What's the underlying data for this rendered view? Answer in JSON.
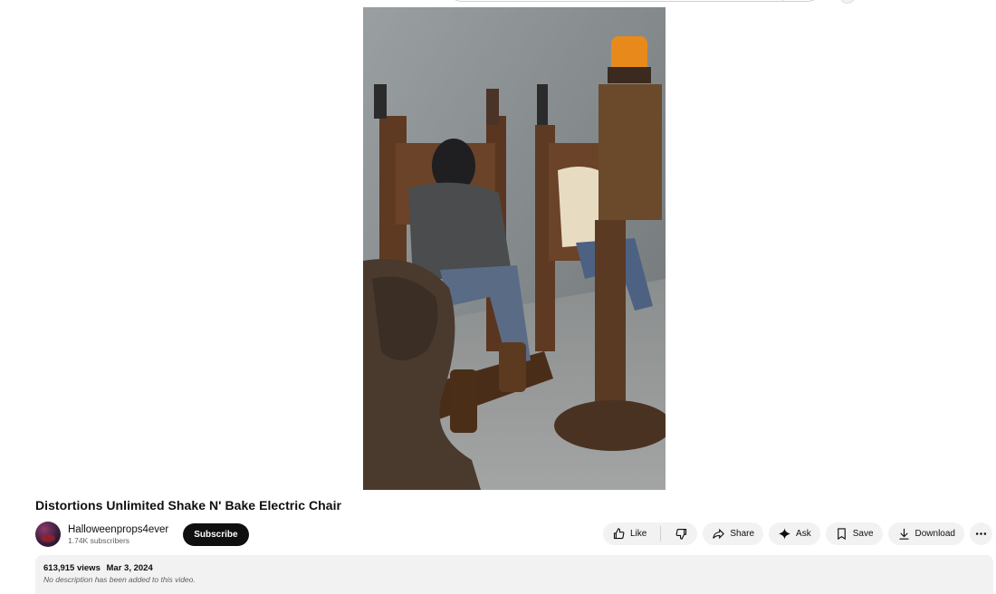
{
  "video": {
    "title": "Distortions Unlimited Shake N' Bake Electric Chair"
  },
  "channel": {
    "name": "Halloweenprops4ever",
    "subscribers": "1.74K subscribers",
    "subscribe_label": "Subscribe"
  },
  "actions": {
    "like": "Like",
    "share": "Share",
    "ask": "Ask",
    "save": "Save",
    "download": "Download"
  },
  "description": {
    "views": "613,915 views",
    "date": "Mar 3, 2024",
    "text": "No description has been added to this video."
  },
  "icons": [
    "thumbs-up-icon",
    "thumbs-down-icon",
    "share-icon",
    "sparkle-icon",
    "bookmark-icon",
    "download-icon",
    "more-icon"
  ]
}
